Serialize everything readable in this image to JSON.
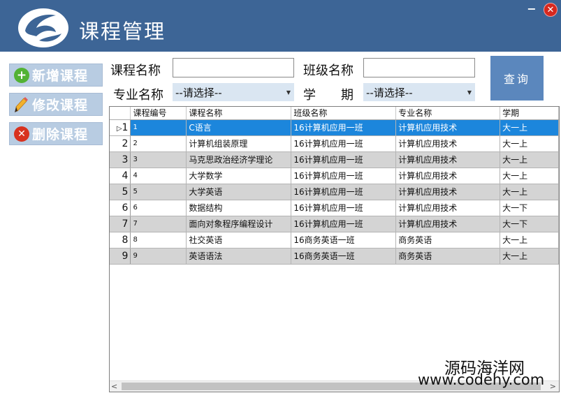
{
  "header": {
    "title": "课程管理"
  },
  "window_controls": {
    "minimize": "−",
    "close": "✕"
  },
  "actions": [
    {
      "label": "新增课程",
      "icon": "plus-circle-icon"
    },
    {
      "label": "修改课程",
      "icon": "pencil-icon"
    },
    {
      "label": "删除课程",
      "icon": "x-circle-icon"
    }
  ],
  "search": {
    "course_name_label": "课程名称",
    "course_name_value": "",
    "class_name_label": "班级名称",
    "class_name_value": "",
    "major_label": "专业名称",
    "major_value": "--请选择--",
    "term_label": "学　　期",
    "term_value": "--请选择--",
    "query_label": "查询"
  },
  "grid": {
    "columns": [
      "课程编号",
      "课程名称",
      "班级名称",
      "专业名称",
      "学期"
    ],
    "rows": [
      {
        "num": "1",
        "id": "1",
        "name": "C语言",
        "class": "16计算机应用一班",
        "major": "计算机应用技术",
        "term": "大一上"
      },
      {
        "num": "2",
        "id": "2",
        "name": "计算机组装原理",
        "class": "16计算机应用一班",
        "major": "计算机应用技术",
        "term": "大一上"
      },
      {
        "num": "3",
        "id": "3",
        "name": "马克思政治经济学理论",
        "class": "16计算机应用一班",
        "major": "计算机应用技术",
        "term": "大一上"
      },
      {
        "num": "4",
        "id": "4",
        "name": "大学数学",
        "class": "16计算机应用一班",
        "major": "计算机应用技术",
        "term": "大一上"
      },
      {
        "num": "5",
        "id": "5",
        "name": "大学英语",
        "class": "16计算机应用一班",
        "major": "计算机应用技术",
        "term": "大一上"
      },
      {
        "num": "6",
        "id": "6",
        "name": "数据结构",
        "class": "16计算机应用一班",
        "major": "计算机应用技术",
        "term": "大一下"
      },
      {
        "num": "7",
        "id": "7",
        "name": "面向对象程序编程设计",
        "class": "16计算机应用一班",
        "major": "计算机应用技术",
        "term": "大一下"
      },
      {
        "num": "8",
        "id": "8",
        "name": "社交英语",
        "class": "16商务英语一班",
        "major": "商务英语",
        "term": "大一上"
      },
      {
        "num": "9",
        "id": "9",
        "name": "英语语法",
        "class": "16商务英语一班",
        "major": "商务英语",
        "term": "大一上"
      }
    ],
    "selected_row": 0
  },
  "watermark": {
    "line1": "源码海洋网",
    "line2": "www.codehy.com"
  },
  "colors": {
    "header": "#3d6596",
    "selection": "#1c86dc",
    "query_button": "#5b87bd"
  }
}
